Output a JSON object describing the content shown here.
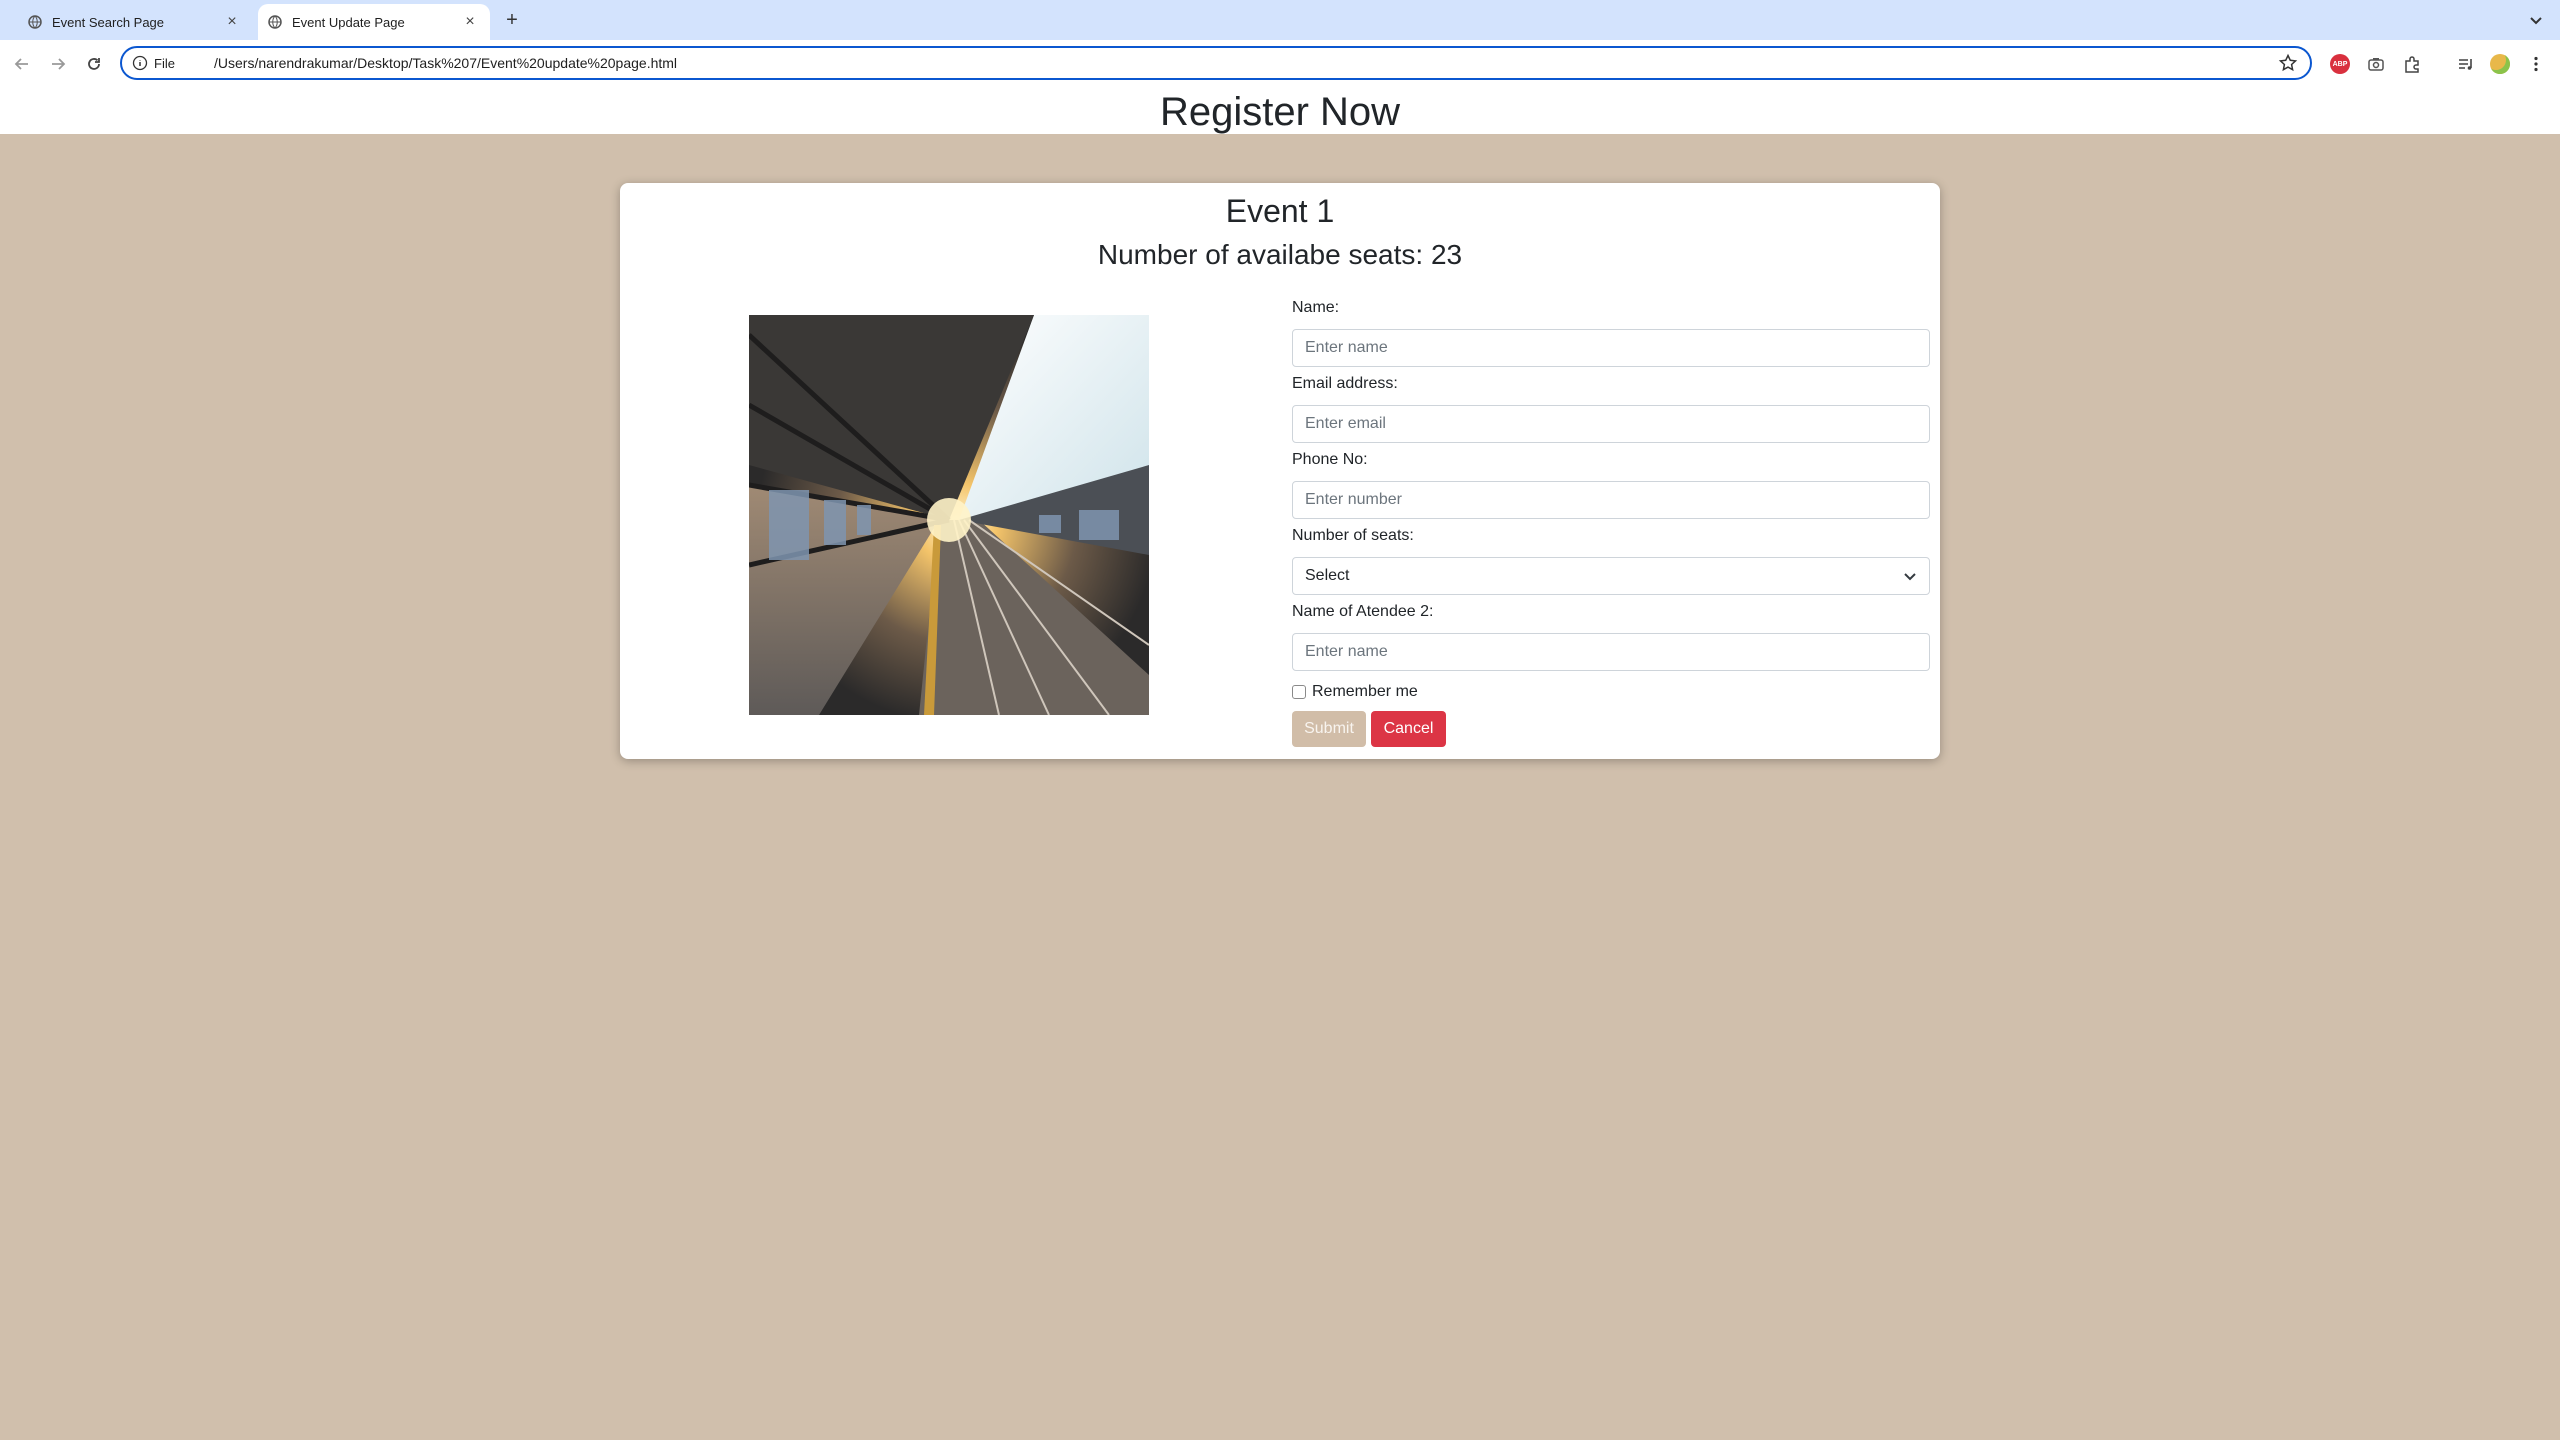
{
  "browser": {
    "tabs": [
      {
        "title": "Event Search Page",
        "active": false
      },
      {
        "title": "Event Update Page",
        "active": true
      }
    ],
    "address": {
      "scheme_label": "File",
      "url": "/Users/narendrakumar/Desktop/Task%207/Event%20update%20page.html"
    },
    "extensions": [
      "adblock-icon",
      "camera-icon",
      "puzzle-icon",
      "media-icon",
      "profile-avatar"
    ]
  },
  "page": {
    "title": "Register Now"
  },
  "event": {
    "name": "Event 1",
    "seats_text": "Number of availabe seats: 23",
    "image_description": "train-platform-photo"
  },
  "form": {
    "name_label": "Name:",
    "name_placeholder": "Enter name",
    "email_label": "Email address:",
    "email_placeholder": "Enter email",
    "phone_label": "Phone No:",
    "phone_placeholder": "Enter number",
    "seats_label": "Number of seats:",
    "seats_selected": "Select",
    "attendee2_label": "Name of Atendee 2:",
    "attendee2_placeholder": "Enter name",
    "remember_label": "Remember me",
    "submit_label": "Submit",
    "cancel_label": "Cancel"
  },
  "colors": {
    "page_background": "#d0bfac",
    "submit_button": "#d1bda8",
    "cancel_button": "#dc3545",
    "focus_ring": "#0b57d0"
  }
}
